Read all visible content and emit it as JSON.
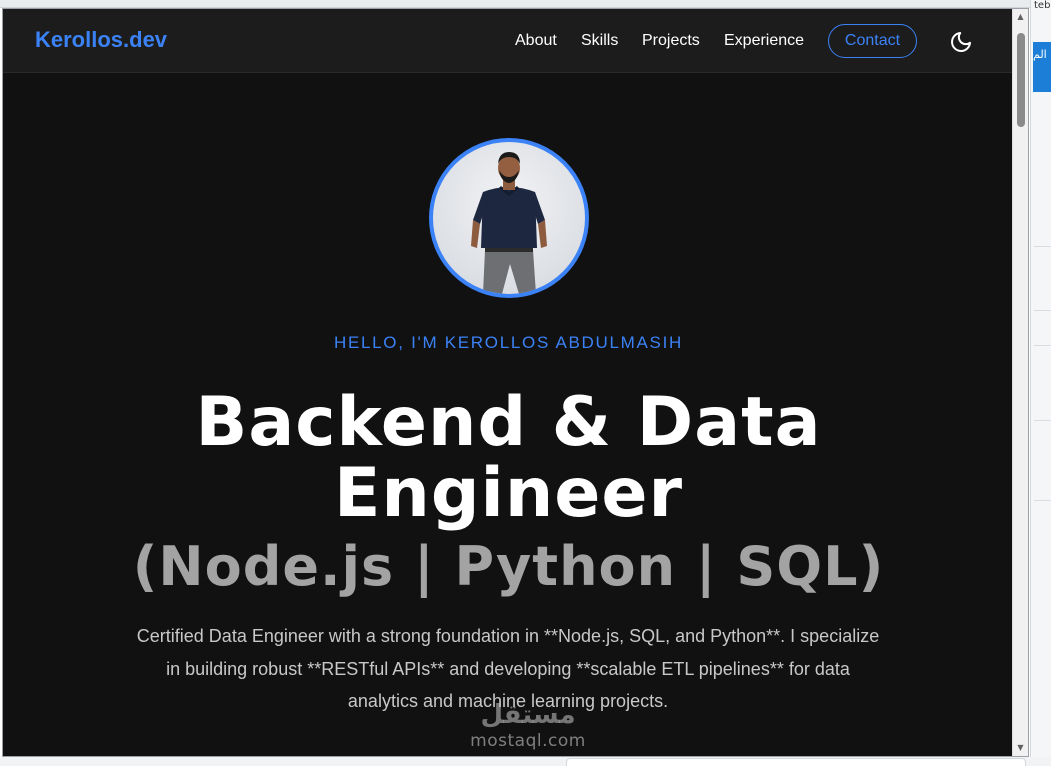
{
  "background": {
    "right_edge_text": "teb",
    "right_edge_arabic": "الم"
  },
  "navbar": {
    "brand": "Kerollos.dev",
    "links": [
      "About",
      "Skills",
      "Projects",
      "Experience"
    ],
    "contact_label": "Contact",
    "theme_icon": "moon-icon"
  },
  "hero": {
    "avatar_icon": "profile-photo",
    "greeting": "HELLO, I'M KEROLLOS ABDULMASIH",
    "headline_line1": "Backend & Data",
    "headline_line2": "Engineer",
    "headline_sub": "(Node.js | Python | SQL)",
    "bio": "Certified Data Engineer with a strong foundation in **Node.js, SQL, and Python**. I specialize in building robust **RESTful APIs** and developing **scalable ETL pipelines** for data analytics and machine learning projects."
  },
  "watermark": {
    "arabic": "مستقل",
    "latin": "mostaql.com"
  },
  "colors": {
    "accent": "#3b82f6",
    "page_bg": "#111111",
    "navbar_bg": "#1c1c1c",
    "headline": "#ffffff",
    "subheadline": "#a3a3a3",
    "body_text": "#c8c8c8"
  }
}
